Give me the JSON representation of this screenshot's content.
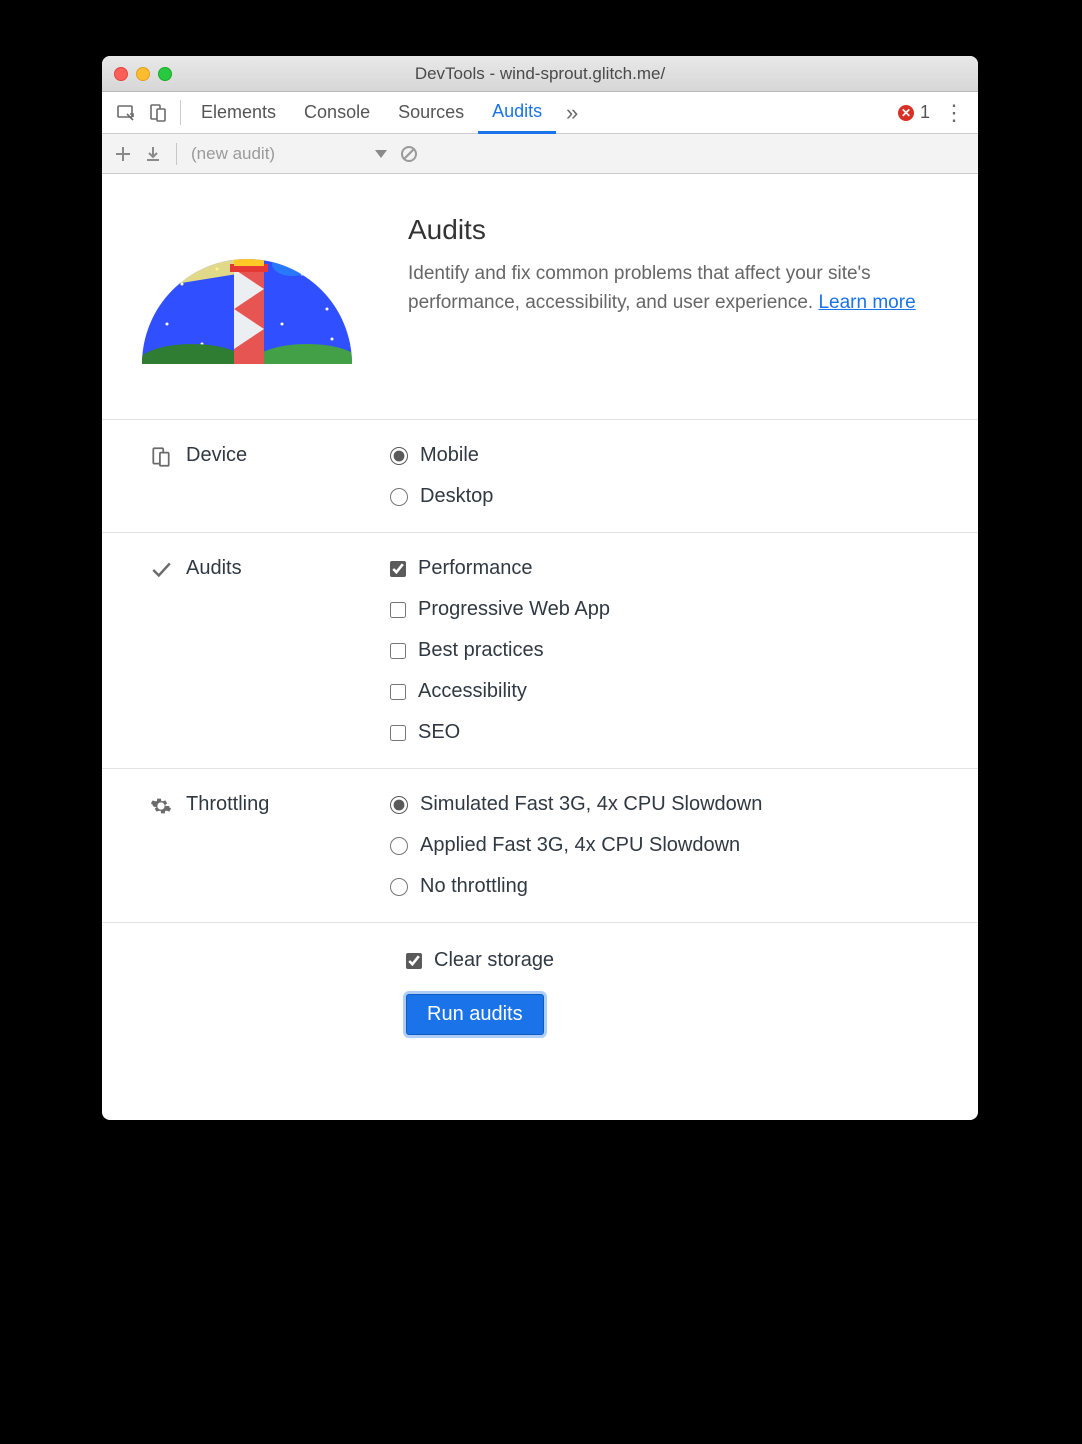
{
  "window": {
    "title": "DevTools - wind-sprout.glitch.me/"
  },
  "tabs": {
    "items": [
      "Elements",
      "Console",
      "Sources",
      "Audits"
    ],
    "active_index": 3,
    "errors_count": "1"
  },
  "toolbar": {
    "audit_selector_label": "(new audit)"
  },
  "intro": {
    "heading": "Audits",
    "description_prefix": "Identify and fix common problems that affect your site's performance, accessibility, and user experience. ",
    "learn_more_label": "Learn more"
  },
  "device": {
    "section_label": "Device",
    "options": [
      {
        "label": "Mobile",
        "checked": true
      },
      {
        "label": "Desktop",
        "checked": false
      }
    ]
  },
  "audits": {
    "section_label": "Audits",
    "options": [
      {
        "label": "Performance",
        "checked": true
      },
      {
        "label": "Progressive Web App",
        "checked": false
      },
      {
        "label": "Best practices",
        "checked": false
      },
      {
        "label": "Accessibility",
        "checked": false
      },
      {
        "label": "SEO",
        "checked": false
      }
    ]
  },
  "throttling": {
    "section_label": "Throttling",
    "options": [
      {
        "label": "Simulated Fast 3G, 4x CPU Slowdown",
        "checked": true
      },
      {
        "label": "Applied Fast 3G, 4x CPU Slowdown",
        "checked": false
      },
      {
        "label": "No throttling",
        "checked": false
      }
    ]
  },
  "run": {
    "clear_storage_label": "Clear storage",
    "clear_storage_checked": true,
    "button_label": "Run audits"
  }
}
